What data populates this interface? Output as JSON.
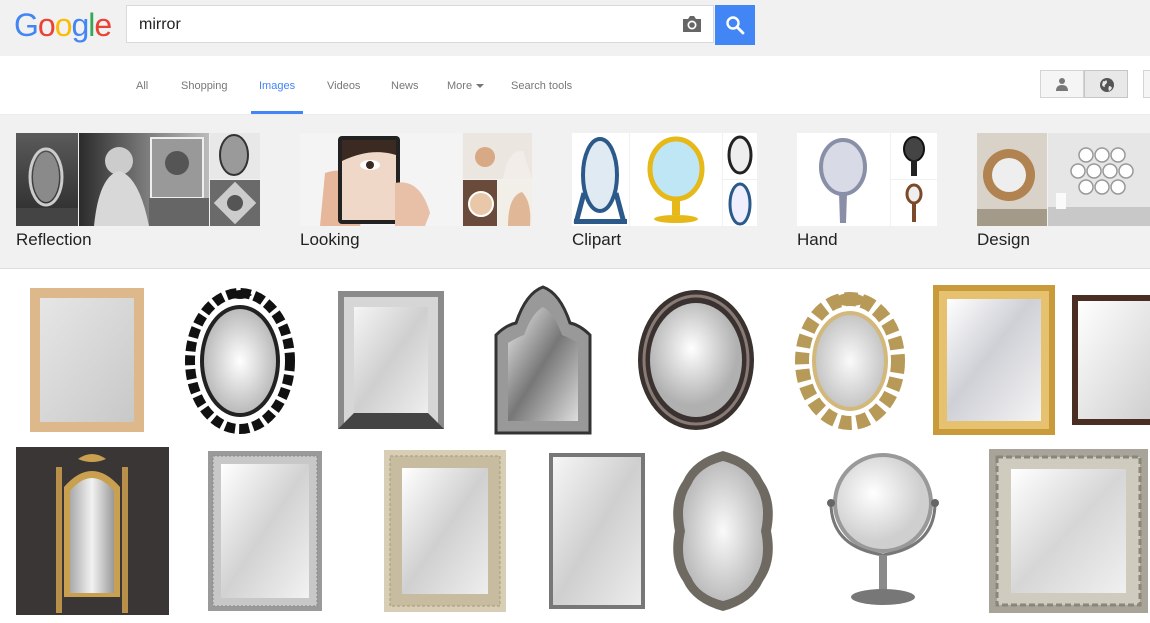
{
  "logo": {
    "letters": [
      "G",
      "o",
      "o",
      "g",
      "l",
      "e"
    ]
  },
  "search": {
    "value": "mirror"
  },
  "tabs": [
    {
      "label": "All"
    },
    {
      "label": "Shopping"
    },
    {
      "label": "Images"
    },
    {
      "label": "Videos"
    },
    {
      "label": "News"
    },
    {
      "label": "More"
    },
    {
      "label": "Search tools"
    }
  ],
  "active_tab": "Images",
  "related": [
    {
      "label": "Reflection"
    },
    {
      "label": "Looking"
    },
    {
      "label": "Clipart"
    },
    {
      "label": "Hand"
    },
    {
      "label": "Design"
    }
  ],
  "colors": {
    "brand_blue": "#4285f4",
    "red": "#ea4335",
    "yellow": "#fbbc05",
    "green": "#34a853"
  },
  "icons": [
    "camera-icon",
    "magnifier-icon",
    "person-icon",
    "globe-icon",
    "caret-down-icon"
  ],
  "results_row1": [
    "wood-frame-mirror",
    "black-ornate-oval-mirror",
    "silver-rectangular-mirror",
    "venetian-arched-mirror",
    "dark-ornate-oval-mirror",
    "gold-baroque-oval-mirror",
    "gold-rectangular-frame-mirror",
    "brown-frame-mirror"
  ],
  "results_row2": [
    "gold-cheval-floor-mirror",
    "silver-textured-frame-mirror",
    "cream-carved-frame-mirror",
    "thin-metal-frame-mirror",
    "silver-scalloped-oval-mirror",
    "chrome-vanity-stand-mirror",
    "silver-scroll-frame-mirror"
  ]
}
